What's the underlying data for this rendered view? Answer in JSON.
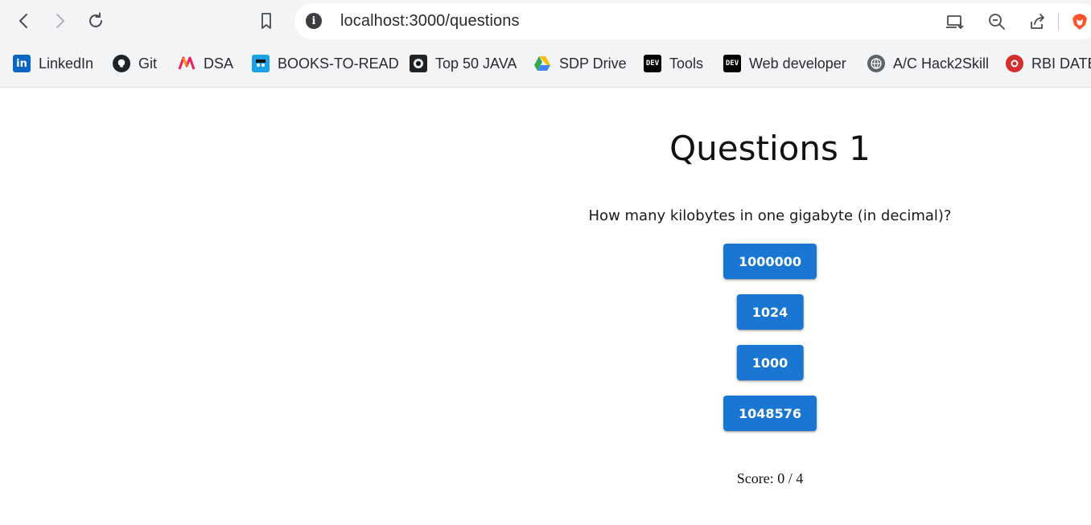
{
  "browser": {
    "url": "localhost:3000/questions",
    "bookmarks": [
      {
        "label": "LinkedIn",
        "icon": "linkedin-icon",
        "color": "#0a66c2"
      },
      {
        "label": "Git",
        "icon": "github-icon",
        "color": "#1f2328"
      },
      {
        "label": "DSA",
        "icon": "dsa-icon",
        "color": "#e91e63"
      },
      {
        "label": "BOOKS-TO-READ",
        "icon": "books-icon",
        "color": "#1aa1e6"
      },
      {
        "label": "Top 50 JAVA",
        "icon": "java-icon",
        "color": "#222222"
      },
      {
        "label": "SDP Drive",
        "icon": "google-drive-icon",
        "color": "#34a853"
      },
      {
        "label": "Tools",
        "icon": "dev-icon",
        "color": "#000000",
        "badge": "DEV"
      },
      {
        "label": "Web developer",
        "icon": "dev-icon",
        "color": "#000000",
        "badge": "DEV"
      },
      {
        "label": "A/C Hack2Skill",
        "icon": "globe-icon",
        "color": "#5f6368"
      },
      {
        "label": "RBI DATES",
        "icon": "rbi-icon",
        "color": "#d32f2f"
      }
    ]
  },
  "quiz": {
    "title": "Questions 1",
    "question": "How many kilobytes in one gigabyte (in decimal)?",
    "answers": [
      "1000000",
      "1024",
      "1000",
      "1048576"
    ],
    "score_text": "Score: 0 / 4"
  },
  "colors": {
    "button": "#1976d2",
    "chrome": "#f3f4f6"
  }
}
